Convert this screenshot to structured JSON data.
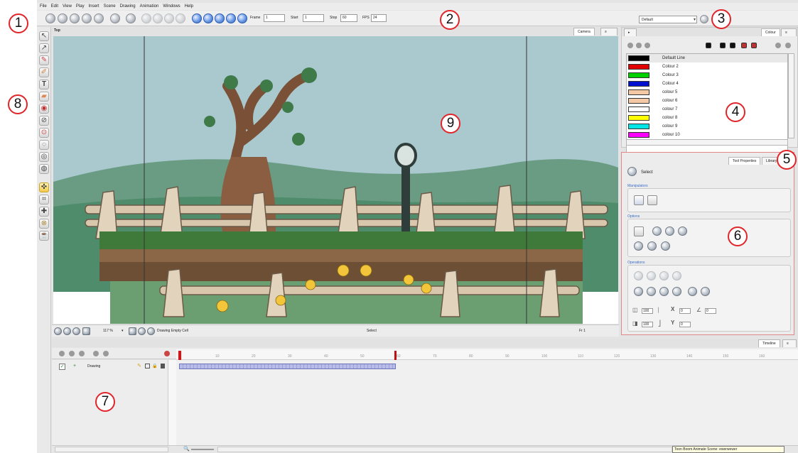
{
  "menubar": [
    "File",
    "Edit",
    "View",
    "Play",
    "Insert",
    "Scene",
    "Drawing",
    "Animation",
    "Windows",
    "Help"
  ],
  "playback": {
    "frame_label": "Frame",
    "frame_value": "1",
    "start_label": "Start",
    "start_value": "1",
    "stop_label": "Stop",
    "stop_value": "60",
    "fps_label": "FPS",
    "fps_value": "24"
  },
  "workspace": {
    "selected": "Default"
  },
  "view": {
    "breadcrumb": "Top",
    "tabs": [
      "Camera"
    ],
    "zoom": "117 %",
    "status_left": "Drawing Empty Cell",
    "status_mid": "Select",
    "status_right": "Fr 1"
  },
  "colour_panel": {
    "tab": "Colour",
    "swatches": [
      {
        "name": "Default Line",
        "color": "#000000"
      },
      {
        "name": "Colour 2",
        "color": "#e00000"
      },
      {
        "name": "Colour 3",
        "color": "#00d000"
      },
      {
        "name": "Colour 4",
        "color": "#0010d0"
      },
      {
        "name": "colour 5",
        "color": "#f6c9a6"
      },
      {
        "name": "colour 6",
        "color": "#f6c9a6"
      },
      {
        "name": "colour 7",
        "color": "#ffffff"
      },
      {
        "name": "colour 8",
        "color": "#ffff00"
      },
      {
        "name": "colour 9",
        "color": "#00e6e6"
      },
      {
        "name": "colour 10",
        "color": "#ff00ff"
      }
    ]
  },
  "tool_properties": {
    "tabs": [
      "Tool Properties",
      "Library"
    ],
    "tool_name": "Select",
    "sections": {
      "manipulators": "Manipulators",
      "options": "Options",
      "operations": "Operations"
    },
    "fields": {
      "width": "100",
      "height": "100",
      "x": "0",
      "y": "0",
      "angle": "0"
    }
  },
  "timeline": {
    "tab": "Timeline",
    "layer_name": "Drawing",
    "ruler_ticks": [
      "10",
      "20",
      "30",
      "40",
      "50",
      "60",
      "70",
      "80",
      "90",
      "100",
      "110",
      "120",
      "130",
      "140",
      "150",
      "160"
    ]
  },
  "status_tip": "Toon Boom Animate Scene: ewerwewer",
  "callouts": [
    "1",
    "2",
    "3",
    "4",
    "5",
    "6",
    "7",
    "8",
    "9"
  ],
  "icons": {
    "toolbar": [
      "new-scene-icon",
      "open-icon",
      "save-icon",
      "save-all-icon",
      "import-icon",
      "undo-icon",
      "redo-icon",
      "cut-icon",
      "copy-icon",
      "paste-icon",
      "delete-icon",
      "first-frame-icon",
      "play-icon",
      "previous-frame-icon",
      "next-frame-icon",
      "last-frame-icon"
    ],
    "tools": [
      "select-icon",
      "contour-editor-icon",
      "brush-icon",
      "pencil-icon",
      "text-icon",
      "eraser-icon",
      "paint-icon",
      "dropper-icon",
      "zoom-icon",
      "rotate-icon",
      "hand-icon",
      "transform-icon",
      "cutter-icon",
      "grid-icon",
      "morph-icon",
      "pot-icon"
    ]
  }
}
